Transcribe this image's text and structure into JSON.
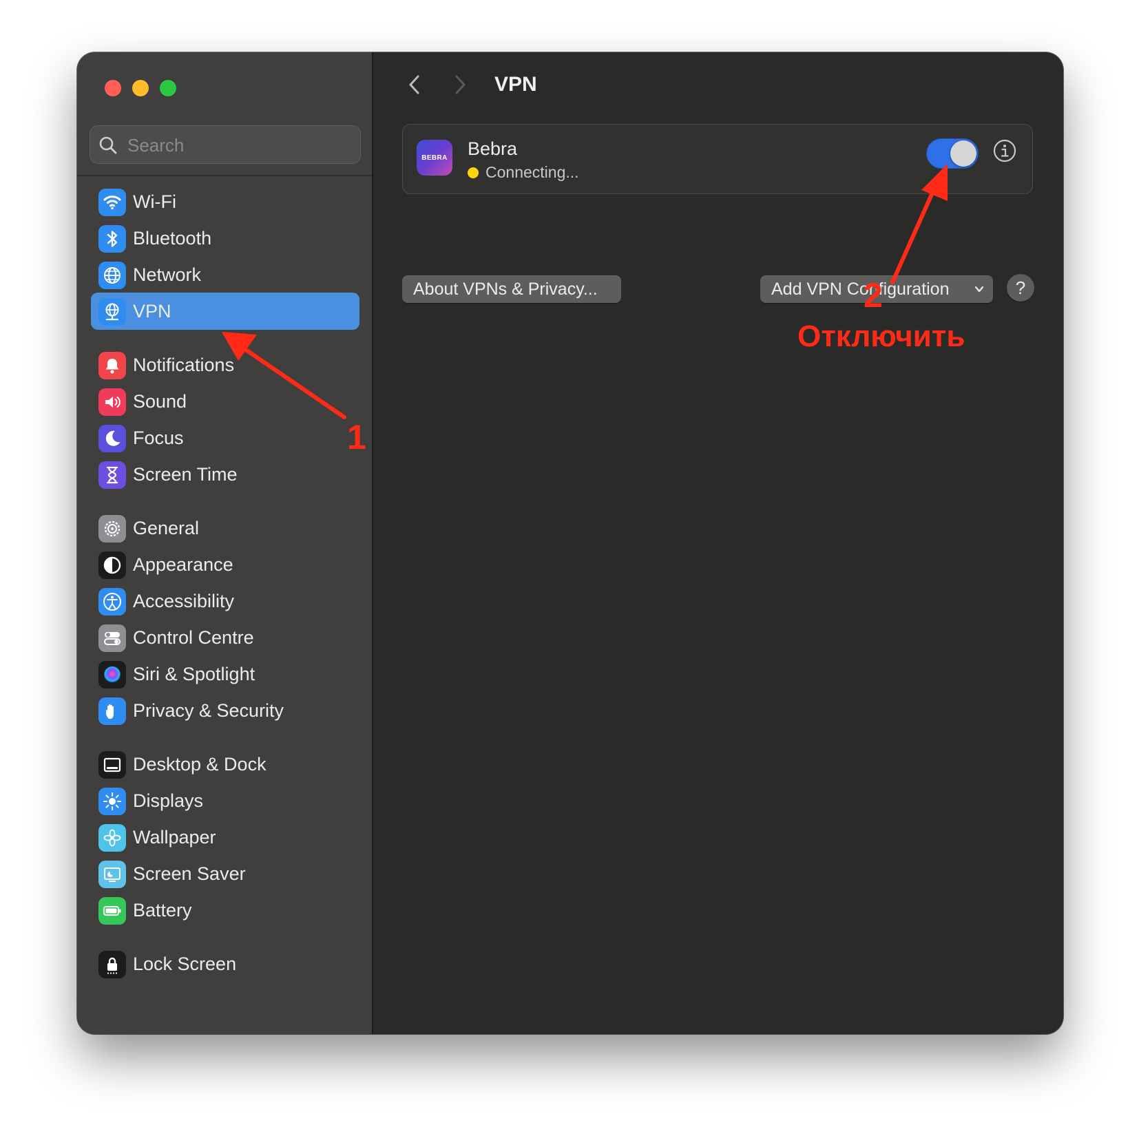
{
  "search": {
    "placeholder": "Search"
  },
  "sidebar": {
    "items": [
      {
        "label": "Wi-Fi",
        "icon": "wifi-icon",
        "color": "#2f8cf0"
      },
      {
        "label": "Bluetooth",
        "icon": "bluetooth-icon",
        "color": "#2f8cf0"
      },
      {
        "label": "Network",
        "icon": "globe-icon",
        "color": "#2f8cf0"
      },
      {
        "label": "VPN",
        "icon": "vpn-globe-icon",
        "color": "#2f8cf0",
        "selected": true
      },
      {
        "label": "Notifications",
        "icon": "bell-icon",
        "color": "#f0454a"
      },
      {
        "label": "Sound",
        "icon": "speaker-icon",
        "color": "#f03b5a"
      },
      {
        "label": "Focus",
        "icon": "moon-icon",
        "color": "#5b4fe0"
      },
      {
        "label": "Screen Time",
        "icon": "hourglass-icon",
        "color": "#6a4fe0"
      },
      {
        "label": "General",
        "icon": "gear-icon",
        "color": "#8e8e93"
      },
      {
        "label": "Appearance",
        "icon": "appearance-icon",
        "color": "#1c1c1e"
      },
      {
        "label": "Accessibility",
        "icon": "accessibility-icon",
        "color": "#2f8cf0"
      },
      {
        "label": "Control Centre",
        "icon": "toggles-icon",
        "color": "#8e8e93"
      },
      {
        "label": "Siri & Spotlight",
        "icon": "siri-icon",
        "color": "#1c1c1e"
      },
      {
        "label": "Privacy & Security",
        "icon": "hand-icon",
        "color": "#2f8cf0"
      },
      {
        "label": "Desktop & Dock",
        "icon": "dock-icon",
        "color": "#1c1c1e"
      },
      {
        "label": "Displays",
        "icon": "sun-icon",
        "color": "#2f8cf0"
      },
      {
        "label": "Wallpaper",
        "icon": "flower-icon",
        "color": "#4ec4ea"
      },
      {
        "label": "Screen Saver",
        "icon": "screensaver-icon",
        "color": "#5fc2ea"
      },
      {
        "label": "Battery",
        "icon": "battery-icon",
        "color": "#34c759"
      },
      {
        "label": "Lock Screen",
        "icon": "lock-icon",
        "color": "#1c1c1e"
      }
    ]
  },
  "content": {
    "title": "VPN",
    "vpn": {
      "name": "Bebra",
      "logo_text": "BEBRA",
      "status": "Connecting...",
      "status_color": "#ffd60a",
      "enabled": true
    },
    "about_button": "About VPNs & Privacy...",
    "add_button": "Add VPN Configuration",
    "help_label": "?"
  },
  "annotations": {
    "step1": "1",
    "step2": "2",
    "step2_label": "Отключить",
    "color": "#ff2a17"
  }
}
